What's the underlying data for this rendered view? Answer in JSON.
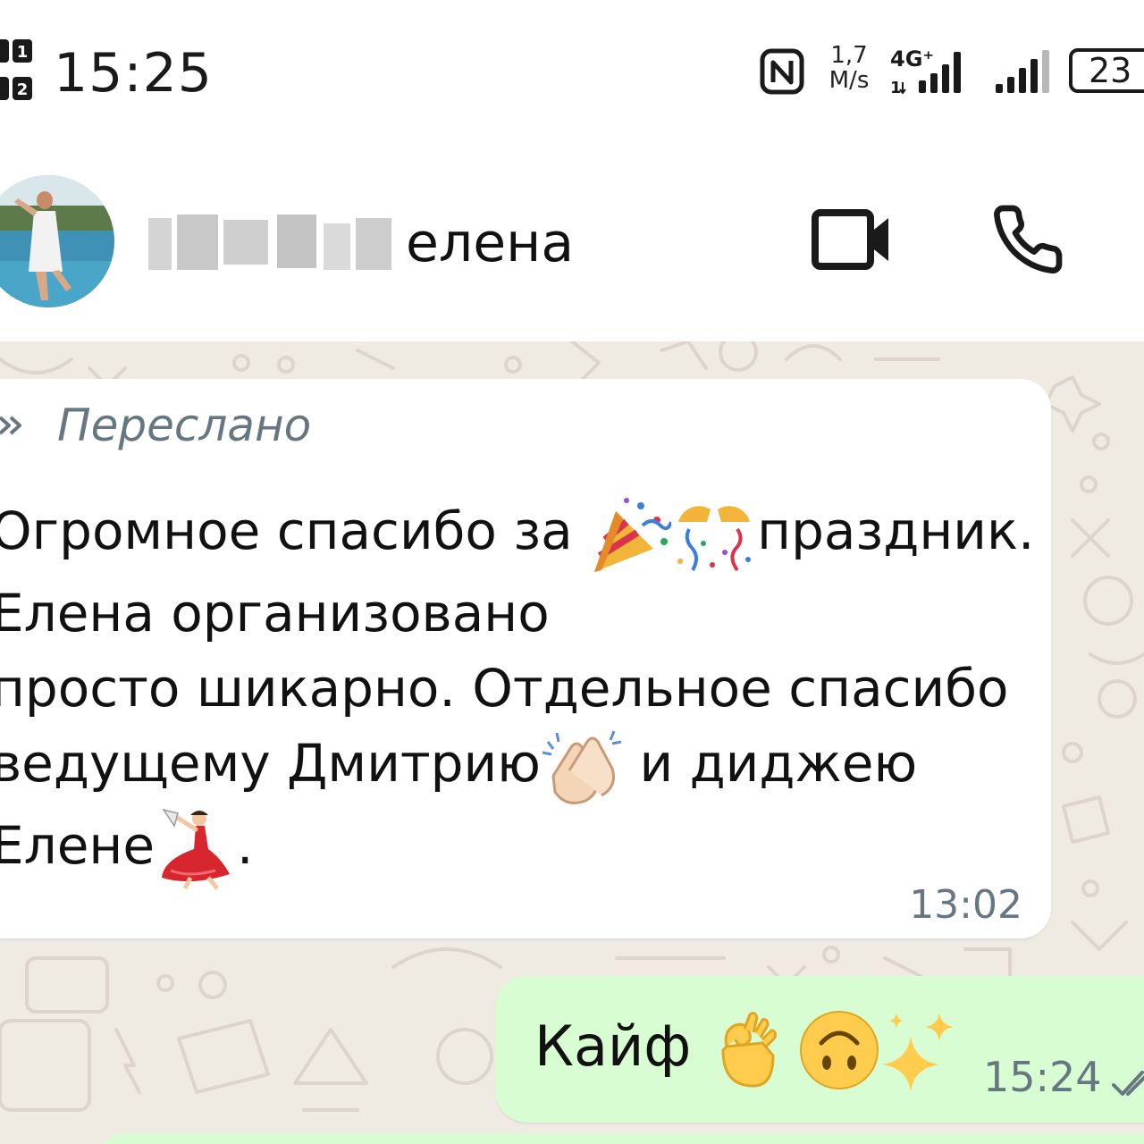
{
  "status_bar": {
    "time": "15:25",
    "net_speed_value": "1,7",
    "net_speed_unit": "M/s",
    "network_type": "4G⁺",
    "battery_level": "23",
    "sim_labels": [
      "1",
      "2"
    ]
  },
  "header": {
    "contact_name_visible": "елена",
    "contact_name_obscured": true
  },
  "messages": [
    {
      "direction": "incoming",
      "forwarded_label": "Переслано",
      "text_line1": "Огромное спасибо за ",
      "text_rest": "праздник. Елена организовано\nпросто шикарно. Отдельное спасибо\nведущему Дмитрию",
      "text_mid": " и диджею\nЕлене",
      "text_end": ".",
      "emojis": [
        "party-popper",
        "confetti-ball",
        "clapping-hands",
        "flamenco-dancer"
      ],
      "time": "13:02"
    },
    {
      "direction": "outgoing",
      "text": "Кайф ",
      "emojis": [
        "ok-hand",
        "upside-down-face",
        "sparkles"
      ],
      "time": "15:24",
      "status": "read"
    }
  ],
  "colors": {
    "chat_background": "#efeae2",
    "incoming_bubble": "#ffffff",
    "outgoing_bubble": "#d9fdd3",
    "meta_text": "#667781",
    "read_ticks": "#667781"
  }
}
